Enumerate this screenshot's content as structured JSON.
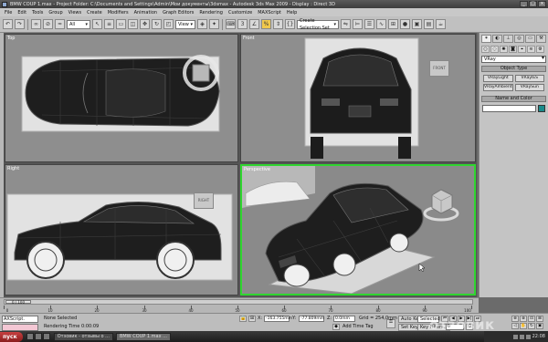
{
  "window": {
    "title": "BMW COUP 1.max     - Project Folder: C:\\Documents and Settings\\Admin\\Мои документы\\3dsmax     - Autodesk 3ds Max  2009     - Display : Direct 3D",
    "min": "_",
    "max": "□",
    "close": "×"
  },
  "menu": [
    "File",
    "Edit",
    "Tools",
    "Group",
    "Views",
    "Create",
    "Modifiers",
    "Animation",
    "Graph Editors",
    "Rendering",
    "Customize",
    "MAXScript",
    "Help"
  ],
  "toolbar": {
    "filter_value": "All",
    "refcoord_value": "View",
    "selection_set_placeholder": "Create Selection Set"
  },
  "viewports": {
    "top": {
      "label": "Top"
    },
    "front": {
      "label": "Front",
      "cube": "FRONT"
    },
    "right": {
      "label": "Right",
      "cube": "RIGHT"
    },
    "perspective": {
      "label": "Perspective"
    }
  },
  "command_panel": {
    "renderer_dropdown": "VRay",
    "object_type_header": "Object Type",
    "object_buttons": [
      "VRayLight",
      "VRayIES",
      "VRayAmbientLig",
      "VRaySun"
    ],
    "name_color_header": "Name and Color",
    "accent_color": "#1a8a8a"
  },
  "timeline": {
    "frame_display": "0 / 100",
    "ticks": [
      "0",
      "10",
      "20",
      "30",
      "40",
      "50",
      "60",
      "70",
      "80",
      "90",
      "100"
    ]
  },
  "status": {
    "maxscript_label": "AXScript.",
    "selection_status": "None Selected",
    "render_time": "Rendering Time  0:00:09",
    "x_value": "-163.755mm",
    "y_value": "-77.809mm",
    "z_value": "0.0mm",
    "grid_value": "Grid = 254,0mm",
    "add_time_tag": "Add Time Tag",
    "auto_key": "Auto Key",
    "set_key": "Set Key",
    "key_filter": "Selected",
    "key_filters_btn": "Key Filters...",
    "frame_spinner": "0"
  },
  "taskbar": {
    "start_label": "пуск",
    "tasks": [
      "Отзовик - отзывы о ...",
      "BMW COUP 1.max ..."
    ],
    "clock": "22:08"
  },
  "watermark": "отзовик"
}
